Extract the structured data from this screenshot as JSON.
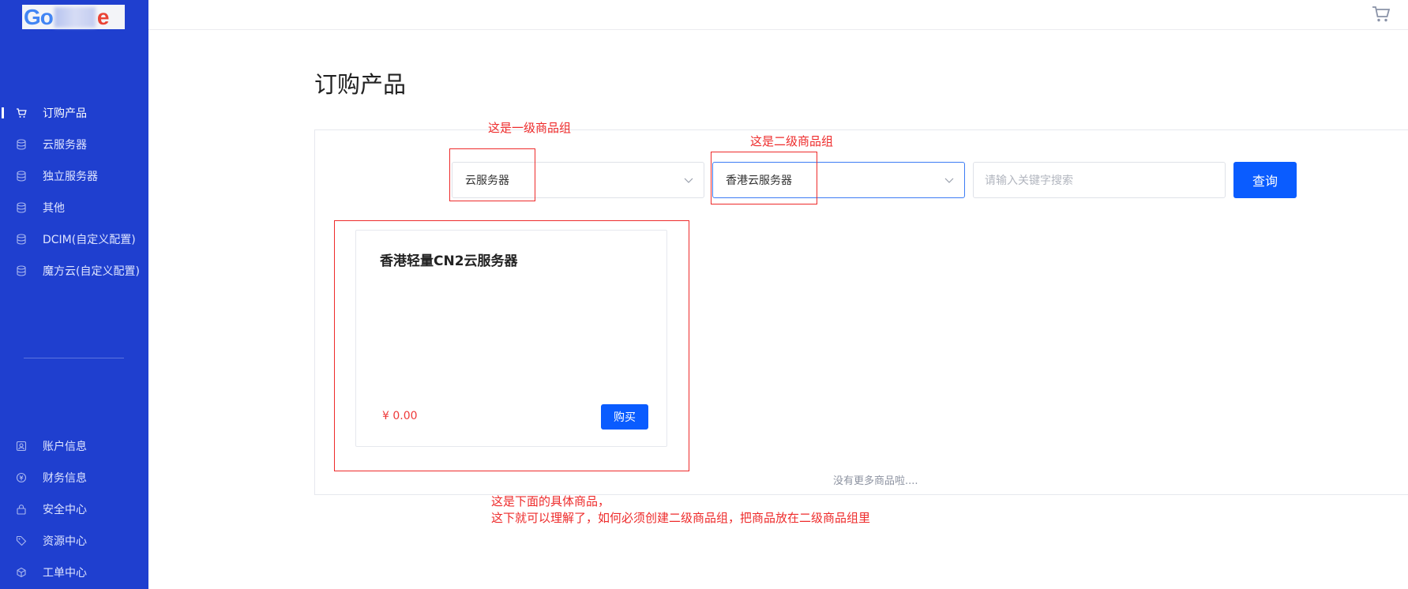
{
  "sidebar": {
    "logo_text": "Google",
    "nav": [
      {
        "label": "订购产品",
        "icon": "cart-icon",
        "active": true
      },
      {
        "label": "云服务器",
        "icon": "database-icon"
      },
      {
        "label": "独立服务器",
        "icon": "database-icon"
      },
      {
        "label": "其他",
        "icon": "database-icon"
      },
      {
        "label": "DCIM(自定义配置)",
        "icon": "database-icon"
      },
      {
        "label": "魔方云(自定义配置)",
        "icon": "database-icon"
      }
    ],
    "bottom_nav": [
      {
        "label": "账户信息",
        "icon": "user-card-icon"
      },
      {
        "label": "财务信息",
        "icon": "coin-icon"
      },
      {
        "label": "安全中心",
        "icon": "lock-icon"
      },
      {
        "label": "资源中心",
        "icon": "tag-icon"
      },
      {
        "label": "工单中心",
        "icon": "cube-icon"
      }
    ]
  },
  "page": {
    "title": "订购产品"
  },
  "filters": {
    "group1_value": "云服务器",
    "group2_value": "香港云服务器",
    "search_placeholder": "请输入关键字搜索",
    "query_label": "查询"
  },
  "products": [
    {
      "name": "香港轻量CN2云服务器",
      "price": "¥  0.00",
      "buy_label": "购买"
    }
  ],
  "no_more_text": "没有更多商品啦....",
  "annotations": {
    "group1_note": "这是一级商品组",
    "group2_note": "这是二级商品组",
    "product_note_line1": "这是下面的具体商品，",
    "product_note_line2": "这下就可以理解了，如何必须创建二级商品组，把商品放在二级商品组里",
    "color": "#ee2b2b"
  },
  "colors": {
    "sidebar": "#1f3fcf",
    "primary": "#0a5cff",
    "price": "#ee3a3a"
  }
}
